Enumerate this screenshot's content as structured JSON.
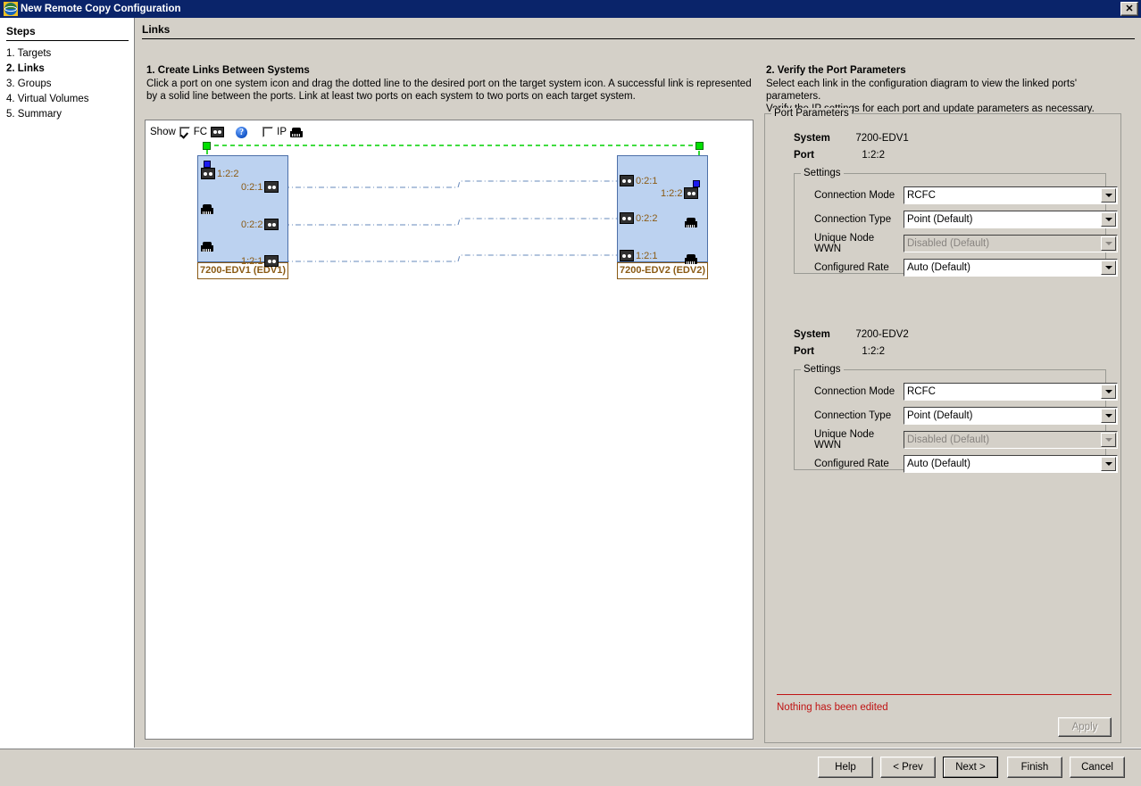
{
  "window": {
    "title": "New Remote Copy Configuration",
    "close_label": "✕",
    "icon": "app-globe-icon"
  },
  "sidebar": {
    "header": "Steps",
    "items": [
      {
        "label": "1. Targets",
        "current": false
      },
      {
        "label": "2. Links",
        "current": true
      },
      {
        "label": "3. Groups",
        "current": false
      },
      {
        "label": "4. Virtual Volumes",
        "current": false
      },
      {
        "label": "5. Summary",
        "current": false
      }
    ]
  },
  "page": {
    "header": "Links"
  },
  "left_section": {
    "title": "1. Create Links Between Systems",
    "description": "Click a port on one system icon and drag the dotted line to the desired port on the target system icon. A successful link is represented by a solid line between the ports. Link at least two ports on each system to two ports on each target system.",
    "show_bar": {
      "show_label": "Show",
      "fc_label": "FC",
      "fc_checked": true,
      "ip_label": "IP",
      "ip_checked": false,
      "help_glyph": "?"
    },
    "diagram": {
      "systems": [
        {
          "name": "7200-EDV1 (EDV1)",
          "side": "left",
          "ports": [
            {
              "id": "1:2:2",
              "type": "fc",
              "selected": true,
              "align": "left"
            },
            {
              "id": "",
              "type": "ip",
              "align": "left"
            },
            {
              "id": "",
              "type": "ip",
              "align": "left"
            },
            {
              "id": "0:2:1",
              "type": "fc",
              "align": "right"
            },
            {
              "id": "0:2:2",
              "type": "fc",
              "align": "right"
            },
            {
              "id": "1:2:1",
              "type": "fc",
              "align": "right"
            }
          ]
        },
        {
          "name": "7200-EDV2 (EDV2)",
          "side": "right",
          "ports": [
            {
              "id": "0:2:1",
              "type": "fc",
              "align": "left"
            },
            {
              "id": "0:2:2",
              "type": "fc",
              "align": "left"
            },
            {
              "id": "1:2:1",
              "type": "fc",
              "align": "left"
            },
            {
              "id": "1:2:2",
              "type": "fc",
              "selected": true,
              "align": "right"
            },
            {
              "id": "",
              "type": "ip",
              "align": "right"
            },
            {
              "id": "",
              "type": "ip",
              "align": "right"
            }
          ]
        }
      ],
      "links": [
        {
          "from": "1:2:2",
          "to": "1:2:2",
          "state": "selected",
          "color": "#00d000",
          "style": "dashed"
        },
        {
          "from": "0:2:1",
          "to": "0:2:1",
          "state": "normal",
          "color": "#6688bb",
          "style": "dash-dot"
        },
        {
          "from": "0:2:2",
          "to": "0:2:2",
          "state": "normal",
          "color": "#6688bb",
          "style": "dash-dot"
        },
        {
          "from": "1:2:1",
          "to": "1:2:1",
          "state": "normal",
          "color": "#6688bb",
          "style": "dash-dot"
        }
      ]
    }
  },
  "right_section": {
    "title": "2. Verify the Port Parameters",
    "description_line1": "Select each link in the configuration diagram to view the linked ports' parameters.",
    "description_line2": "Verify the IP settings for each port and update parameters as necessary.",
    "group_title": "Port Parameters",
    "ports": [
      {
        "system_label": "System",
        "system_value": "7200-EDV1",
        "port_label": "Port",
        "port_value": "1:2:2",
        "settings_title": "Settings",
        "fields": [
          {
            "label": "Connection Mode",
            "value": "RCFC",
            "disabled": false
          },
          {
            "label": "Connection Type",
            "value": "Point (Default)",
            "disabled": false
          },
          {
            "label": "Unique Node WWN",
            "value": "Disabled (Default)",
            "disabled": true
          },
          {
            "label": "Configured Rate",
            "value": "Auto (Default)",
            "disabled": false
          }
        ]
      },
      {
        "system_label": "System",
        "system_value": "7200-EDV2",
        "port_label": "Port",
        "port_value": "1:2:2",
        "settings_title": "Settings",
        "fields": [
          {
            "label": "Connection Mode",
            "value": "RCFC",
            "disabled": false
          },
          {
            "label": "Connection Type",
            "value": "Point (Default)",
            "disabled": false
          },
          {
            "label": "Unique Node WWN",
            "value": "Disabled (Default)",
            "disabled": true
          },
          {
            "label": "Configured Rate",
            "value": "Auto (Default)",
            "disabled": false
          }
        ]
      }
    ],
    "status_message": "Nothing has been edited",
    "apply_label": "Apply",
    "apply_disabled": true
  },
  "footer": {
    "buttons": [
      {
        "label": "Help",
        "default": false
      },
      {
        "label": "< Prev",
        "default": false
      },
      {
        "label": "Next >",
        "default": true
      },
      {
        "label": "Finish",
        "default": false
      },
      {
        "label": "Cancel",
        "default": false
      }
    ]
  },
  "colors": {
    "window_bg": "#d4d0c8",
    "titlebar": "#0a246a",
    "system_box": "#bcd2f0",
    "system_label_text": "#8a5a14",
    "link_selected": "#00d000",
    "link_normal": "#6688bb",
    "status_text": "#c01414"
  }
}
